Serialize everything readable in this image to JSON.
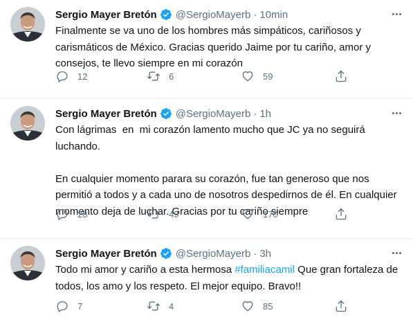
{
  "tweets": [
    {
      "name": "Sergio Mayer Bretón",
      "handle": "@SergioMayerb",
      "separator": "·",
      "time": "10min",
      "text": "Finalmente se va uno de los hombres más simpáticos, cariñosos y carismáticos de México. Gracias querido Jaime por tu cariño, amor y consejos, te llevo siempre en mi corazón",
      "replies": "12",
      "retweets": "6",
      "likes": "59"
    },
    {
      "name": "Sergio Mayer Bretón",
      "handle": "@SergioMayerb",
      "separator": "·",
      "time": "1h",
      "text": "Con lágrimas  en  mi corazón lamento mucho que JC ya no seguirá luchando.\n\nEn cualquier momento parara su corazón, fue tan generoso que nos permitió a todos y a cada uno de nosotros despedirnos de él. En cualquier momento deja de luchar. Gracias por tu cariño siempre",
      "replies": "28",
      "retweets": "49",
      "likes": "170"
    },
    {
      "name": "Sergio Mayer Bretón",
      "handle": "@SergioMayerb",
      "separator": "·",
      "time": "3h",
      "text_before": "Todo mi amor y cariño a esta hermosa ",
      "hashtag": "#familiacamil",
      "text_after": " Que gran fortaleza de todos, los amo y los respeto. El mejor equipo. Bravo!!",
      "replies": "7",
      "retweets": "4",
      "likes": "85"
    }
  ],
  "icons": {
    "verified": "verified-badge-icon",
    "more": "more-icon",
    "reply": "reply-icon",
    "retweet": "retweet-icon",
    "like": "heart-icon",
    "share": "share-icon"
  },
  "colors": {
    "accent": "#1da1f2",
    "secondary_text": "#5b7083",
    "primary_text": "#0f1419",
    "divider": "#e6ecf0"
  }
}
